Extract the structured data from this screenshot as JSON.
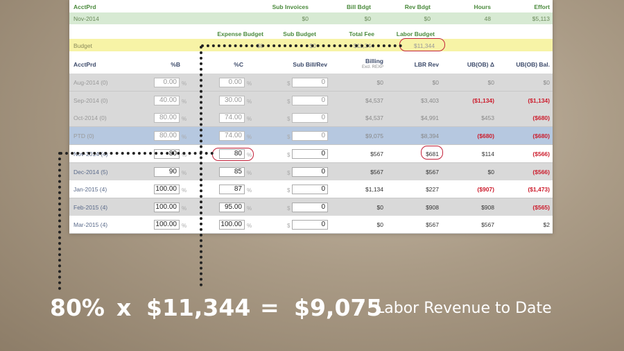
{
  "top_header": {
    "acctprd": "AcctPrd",
    "sub_invoices": "Sub Invoices",
    "bill_bdgt": "Bill Bdgt",
    "rev_bdgt": "Rev Bdgt",
    "hours": "Hours",
    "effort": "Effort"
  },
  "top_row": {
    "period": "Nov-2014",
    "sub_invoices": "$0",
    "bill_bdgt": "$0",
    "rev_bdgt": "$0",
    "hours": "48",
    "effort": "$5,113"
  },
  "budget_header": {
    "expense_budget": "Expense Budget",
    "sub_budget": "Sub Budget",
    "total_fee": "Total Fee",
    "labor_budget": "Labor Budget"
  },
  "budget_row": {
    "label": "Budget",
    "expense_budget": "$0",
    "sub_budget": "$0",
    "total_fee": "$11,344",
    "labor_budget": "$11,344"
  },
  "columns": {
    "acctprd": "AcctPrd",
    "pct_b": "%B",
    "pct_c": "%C",
    "sub_bill_rev": "Sub Bill/Rev",
    "billing": "Billing",
    "billing_sub": "Excl. REXP",
    "lbr_rev": "LBR Rev",
    "ub_ob_delta": "UB(OB) Δ",
    "ub_ob_bal": "UB(OB) Bal."
  },
  "units": {
    "pct": "%",
    "dollar": "$"
  },
  "rows": [
    {
      "period": "Aug-2014 (0)",
      "pct_b": "0.00",
      "pct_c": "0.00",
      "sub": "0",
      "billing": "$0",
      "lbr_rev": "$0",
      "delta": "$0",
      "bal": "$0"
    },
    {
      "period": "Sep-2014 (0)",
      "pct_b": "40.00",
      "pct_c": "30.00",
      "sub": "0",
      "billing": "$4,537",
      "lbr_rev": "$3,403",
      "delta": "($1,134)",
      "bal": "($1,134)"
    },
    {
      "period": "Oct-2014 (0)",
      "pct_b": "80.00",
      "pct_c": "74.00",
      "sub": "0",
      "billing": "$4,537",
      "lbr_rev": "$4,991",
      "delta": "$453",
      "bal": "($680)"
    },
    {
      "period": "PTD (0)",
      "pct_b": "80.00",
      "pct_c": "74.00",
      "sub": "0",
      "billing": "$9,075",
      "lbr_rev": "$8,394",
      "delta": "($680)",
      "bal": "($680)"
    },
    {
      "period": "Nov-2014 (4)",
      "pct_b": "80",
      "pct_c": "80",
      "sub": "0",
      "billing": "$567",
      "lbr_rev": "$681",
      "delta": "$114",
      "bal": "($566)"
    },
    {
      "period": "Dec-2014 (5)",
      "pct_b": "90",
      "pct_c": "85",
      "sub": "0",
      "billing": "$567",
      "lbr_rev": "$567",
      "delta": "$0",
      "bal": "($566)"
    },
    {
      "period": "Jan-2015 (4)",
      "pct_b": "100.00",
      "pct_c": "87",
      "sub": "0",
      "billing": "$1,134",
      "lbr_rev": "$227",
      "delta": "($907)",
      "bal": "($1,473)"
    },
    {
      "period": "Feb-2015 (4)",
      "pct_b": "100.00",
      "pct_c": "95.00",
      "sub": "0",
      "billing": "$0",
      "lbr_rev": "$908",
      "delta": "$908",
      "bal": "($565)"
    },
    {
      "period": "Mar-2015 (4)",
      "pct_b": "100.00",
      "pct_c": "100.00",
      "sub": "0",
      "billing": "$0",
      "lbr_rev": "$567",
      "delta": "$567",
      "bal": "$2"
    }
  ],
  "formula": {
    "percent": "80%",
    "times": "x",
    "amount": "$11,344",
    "equals": "=",
    "result": "$9,075",
    "caption": "Labor Revenue to Date"
  },
  "colors": {
    "negative": "#cc1c2c",
    "highlight_oval": "#c3223a",
    "header_green": "#4a8a3c",
    "ptd_row": "#b6c8e0",
    "budget_row": "#f7f3a6"
  }
}
